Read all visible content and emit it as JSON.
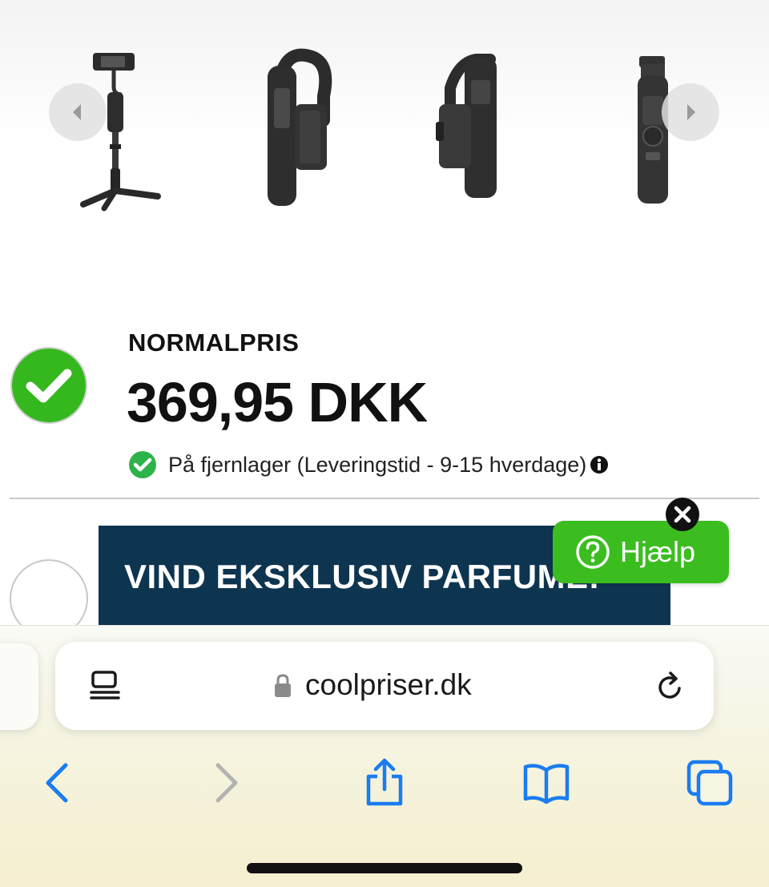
{
  "gallery": {
    "images": [
      "tripod-gimbal",
      "gimbal-side",
      "gimbal-back",
      "gimbal-front"
    ],
    "prev_icon": "chevron-left-icon",
    "next_icon": "chevron-right-icon"
  },
  "product": {
    "price_label": "NORMALPRIS",
    "price": "369,95 DKK",
    "stock_text": "På fjernlager (Leveringstid - 9-15 hverdage)"
  },
  "promo": {
    "banner_text": "VIND EKSKLUSIV PARFUME!"
  },
  "help": {
    "label": "Hjælp"
  },
  "browser": {
    "url": "coolpriser.dk"
  },
  "colors": {
    "accent_green": "#3bbd1f",
    "banner_navy": "#0e3550",
    "ios_blue": "#1a7cf0"
  }
}
